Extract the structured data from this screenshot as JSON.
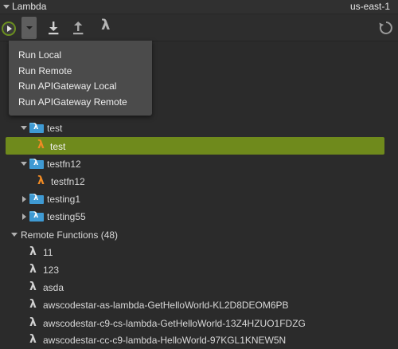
{
  "panel": {
    "title": "Lambda",
    "region": "us-east-1"
  },
  "toolbar": {
    "run_icon": "play-icon",
    "dropdown_icon": "chevron-down-icon",
    "download_icon": "download-icon",
    "upload_icon": "upload-icon",
    "lambda_icon": "lambda-icon",
    "refresh_icon": "refresh-icon"
  },
  "run_menu": {
    "items": [
      "Run Local",
      "Run Remote",
      "Run APIGateway Local",
      "Run APIGateway Remote"
    ]
  },
  "tree": {
    "local": [
      {
        "label": "test",
        "expanded": true,
        "children": [
          {
            "label": "test",
            "selected": true
          }
        ]
      },
      {
        "label": "testfn12",
        "expanded": true,
        "children": [
          {
            "label": "testfn12"
          }
        ]
      },
      {
        "label": "testing1",
        "expanded": false
      },
      {
        "label": "testing55",
        "expanded": false
      }
    ],
    "remote_header": "Remote Functions (48)",
    "remote": [
      "11",
      "123",
      "asda",
      "awscodestar-as-lambda-GetHelloWorld-KL2D8DEOM6PB",
      "awscodestar-c9-cs-lambda-GetHelloWorld-13Z4HZUO1FDZG",
      "awscodestar-cc-c9-lambda-HelloWorld-97KGL1KNEW5N"
    ]
  },
  "colors": {
    "selection": "#6f8a1c",
    "lambda_local": "#f08a24",
    "folder": "#3f9ad3"
  }
}
